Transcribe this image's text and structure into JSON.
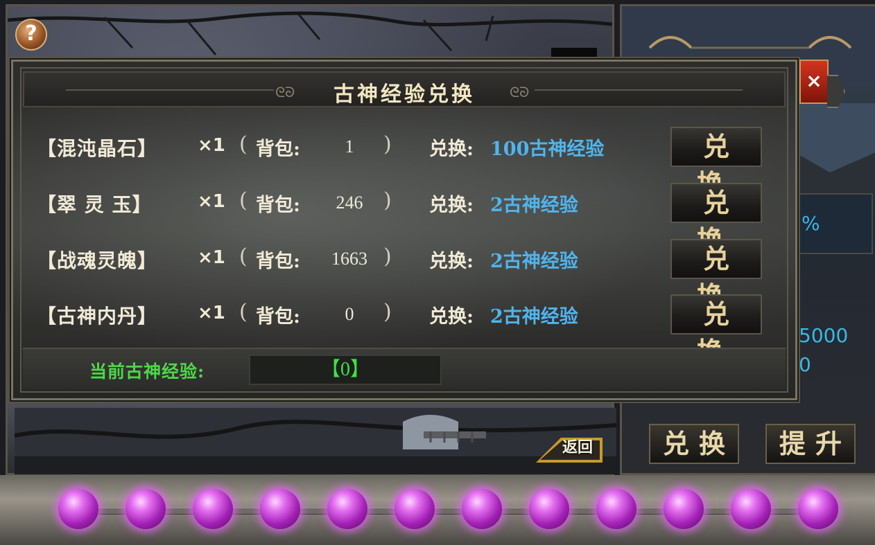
{
  "background": {
    "help_button": "?",
    "back_button": "返回"
  },
  "right_panel": {
    "percent_text": "%",
    "value_1": "5000",
    "value_2": "0",
    "exchange_button": "兑换",
    "upgrade_button": "提升"
  },
  "dialog": {
    "title": "古神经验兑换",
    "close_label": "×",
    "bag_label": "背包:",
    "exchange_label": "兑换:",
    "button_label": "兑换",
    "quantity_label": "×1",
    "rows": [
      {
        "name": "【混沌晶石】",
        "bag_count": "1",
        "reward": "100古神经验"
      },
      {
        "name": "【翠 灵 玉】",
        "bag_count": "246",
        "reward": "2古神经验"
      },
      {
        "name": "【战魂灵魄】",
        "bag_count": "1663",
        "reward": "2古神经验"
      },
      {
        "name": "【古神内丹】",
        "bag_count": "0",
        "reward": "2古神经验"
      }
    ],
    "current_exp_label": "当前古神经验:",
    "current_exp_value": "【0】"
  },
  "orb_count": 12,
  "colors": {
    "reward_blue": "#4fb5ef",
    "exp_green": "#3ce440",
    "orb_purple": "#c44ad8",
    "close_red": "#c0291a"
  }
}
